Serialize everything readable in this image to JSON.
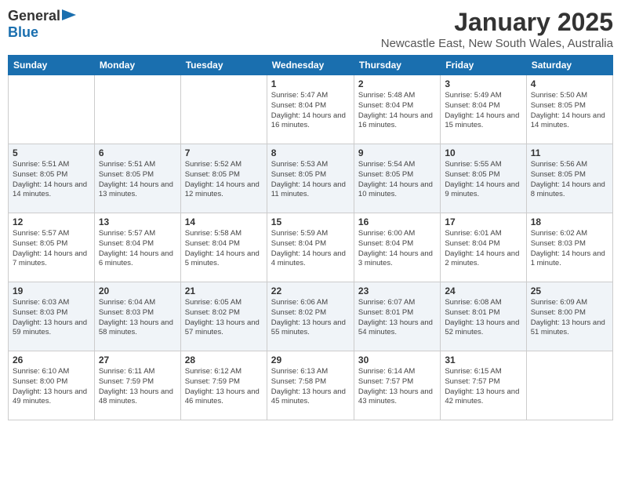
{
  "header": {
    "logo_general": "General",
    "logo_blue": "Blue",
    "month": "January 2025",
    "location": "Newcastle East, New South Wales, Australia"
  },
  "weekdays": [
    "Sunday",
    "Monday",
    "Tuesday",
    "Wednesday",
    "Thursday",
    "Friday",
    "Saturday"
  ],
  "weeks": [
    [
      {
        "day": "",
        "info": ""
      },
      {
        "day": "",
        "info": ""
      },
      {
        "day": "",
        "info": ""
      },
      {
        "day": "1",
        "info": "Sunrise: 5:47 AM\nSunset: 8:04 PM\nDaylight: 14 hours and 16 minutes."
      },
      {
        "day": "2",
        "info": "Sunrise: 5:48 AM\nSunset: 8:04 PM\nDaylight: 14 hours and 16 minutes."
      },
      {
        "day": "3",
        "info": "Sunrise: 5:49 AM\nSunset: 8:04 PM\nDaylight: 14 hours and 15 minutes."
      },
      {
        "day": "4",
        "info": "Sunrise: 5:50 AM\nSunset: 8:05 PM\nDaylight: 14 hours and 14 minutes."
      }
    ],
    [
      {
        "day": "5",
        "info": "Sunrise: 5:51 AM\nSunset: 8:05 PM\nDaylight: 14 hours and 14 minutes."
      },
      {
        "day": "6",
        "info": "Sunrise: 5:51 AM\nSunset: 8:05 PM\nDaylight: 14 hours and 13 minutes."
      },
      {
        "day": "7",
        "info": "Sunrise: 5:52 AM\nSunset: 8:05 PM\nDaylight: 14 hours and 12 minutes."
      },
      {
        "day": "8",
        "info": "Sunrise: 5:53 AM\nSunset: 8:05 PM\nDaylight: 14 hours and 11 minutes."
      },
      {
        "day": "9",
        "info": "Sunrise: 5:54 AM\nSunset: 8:05 PM\nDaylight: 14 hours and 10 minutes."
      },
      {
        "day": "10",
        "info": "Sunrise: 5:55 AM\nSunset: 8:05 PM\nDaylight: 14 hours and 9 minutes."
      },
      {
        "day": "11",
        "info": "Sunrise: 5:56 AM\nSunset: 8:05 PM\nDaylight: 14 hours and 8 minutes."
      }
    ],
    [
      {
        "day": "12",
        "info": "Sunrise: 5:57 AM\nSunset: 8:05 PM\nDaylight: 14 hours and 7 minutes."
      },
      {
        "day": "13",
        "info": "Sunrise: 5:57 AM\nSunset: 8:04 PM\nDaylight: 14 hours and 6 minutes."
      },
      {
        "day": "14",
        "info": "Sunrise: 5:58 AM\nSunset: 8:04 PM\nDaylight: 14 hours and 5 minutes."
      },
      {
        "day": "15",
        "info": "Sunrise: 5:59 AM\nSunset: 8:04 PM\nDaylight: 14 hours and 4 minutes."
      },
      {
        "day": "16",
        "info": "Sunrise: 6:00 AM\nSunset: 8:04 PM\nDaylight: 14 hours and 3 minutes."
      },
      {
        "day": "17",
        "info": "Sunrise: 6:01 AM\nSunset: 8:04 PM\nDaylight: 14 hours and 2 minutes."
      },
      {
        "day": "18",
        "info": "Sunrise: 6:02 AM\nSunset: 8:03 PM\nDaylight: 14 hours and 1 minute."
      }
    ],
    [
      {
        "day": "19",
        "info": "Sunrise: 6:03 AM\nSunset: 8:03 PM\nDaylight: 13 hours and 59 minutes."
      },
      {
        "day": "20",
        "info": "Sunrise: 6:04 AM\nSunset: 8:03 PM\nDaylight: 13 hours and 58 minutes."
      },
      {
        "day": "21",
        "info": "Sunrise: 6:05 AM\nSunset: 8:02 PM\nDaylight: 13 hours and 57 minutes."
      },
      {
        "day": "22",
        "info": "Sunrise: 6:06 AM\nSunset: 8:02 PM\nDaylight: 13 hours and 55 minutes."
      },
      {
        "day": "23",
        "info": "Sunrise: 6:07 AM\nSunset: 8:01 PM\nDaylight: 13 hours and 54 minutes."
      },
      {
        "day": "24",
        "info": "Sunrise: 6:08 AM\nSunset: 8:01 PM\nDaylight: 13 hours and 52 minutes."
      },
      {
        "day": "25",
        "info": "Sunrise: 6:09 AM\nSunset: 8:00 PM\nDaylight: 13 hours and 51 minutes."
      }
    ],
    [
      {
        "day": "26",
        "info": "Sunrise: 6:10 AM\nSunset: 8:00 PM\nDaylight: 13 hours and 49 minutes."
      },
      {
        "day": "27",
        "info": "Sunrise: 6:11 AM\nSunset: 7:59 PM\nDaylight: 13 hours and 48 minutes."
      },
      {
        "day": "28",
        "info": "Sunrise: 6:12 AM\nSunset: 7:59 PM\nDaylight: 13 hours and 46 minutes."
      },
      {
        "day": "29",
        "info": "Sunrise: 6:13 AM\nSunset: 7:58 PM\nDaylight: 13 hours and 45 minutes."
      },
      {
        "day": "30",
        "info": "Sunrise: 6:14 AM\nSunset: 7:57 PM\nDaylight: 13 hours and 43 minutes."
      },
      {
        "day": "31",
        "info": "Sunrise: 6:15 AM\nSunset: 7:57 PM\nDaylight: 13 hours and 42 minutes."
      },
      {
        "day": "",
        "info": ""
      }
    ]
  ]
}
